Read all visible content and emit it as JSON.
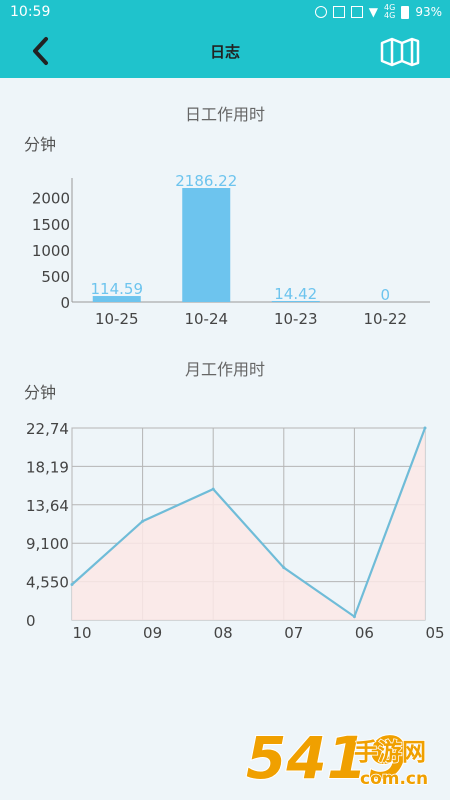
{
  "status_bar": {
    "time": "10:59",
    "net_top": "4G",
    "net_bottom": "4G",
    "battery": "93%",
    "icons": [
      "alarm-icon",
      "vibrate-icon",
      "nfc-icon",
      "wifi-icon",
      "signal-icon",
      "battery-icon"
    ]
  },
  "header": {
    "title": "日志",
    "back_icon": "chevron-left-icon",
    "map_icon": "folded-map-icon"
  },
  "colors": {
    "accent": "#1fc3cc",
    "bar": "#6dc4ee",
    "line": "#6fbcd8",
    "area": "#fbe7e6",
    "watermark": "#f0a000"
  },
  "watermark": {
    "digits": "5419",
    "cn": "手游网",
    "domain": "com.cn"
  },
  "chart_data": [
    {
      "type": "bar",
      "title": "日工作用时",
      "ylabel": "分钟",
      "categories": [
        "10-25",
        "10-24",
        "10-23",
        "10-22"
      ],
      "values": [
        114.59,
        2186.22,
        14.42,
        0
      ],
      "value_labels": [
        "114.59",
        "2186.22",
        "14.42",
        "0"
      ],
      "yticks": [
        "0",
        "500",
        "1000",
        "1500",
        "2000"
      ],
      "ylim": [
        0,
        2186.22
      ]
    },
    {
      "type": "area",
      "title": "月工作用时",
      "ylabel": "分钟",
      "categories": [
        "10",
        "09",
        "08",
        "07",
        "06",
        "05"
      ],
      "values": [
        4200,
        11700,
        15500,
        6200,
        400,
        22740
      ],
      "yticks": [
        "0",
        "4,550",
        "9,100",
        "13,64",
        "18,19",
        "22,74"
      ],
      "ylim": [
        0,
        22740
      ]
    }
  ]
}
